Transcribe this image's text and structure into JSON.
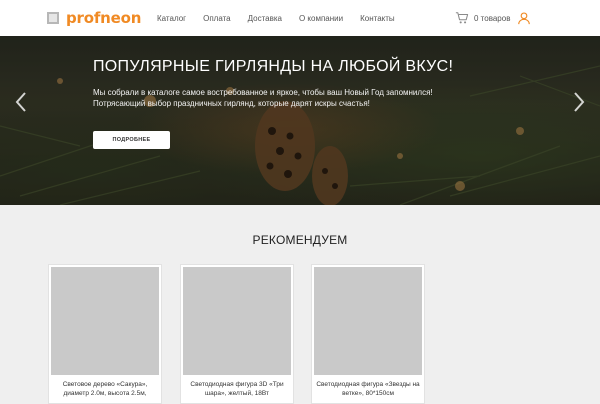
{
  "header": {
    "logo_text": "profneon",
    "nav": [
      "Каталог",
      "Оплата",
      "Доставка",
      "О компании",
      "Контакты"
    ],
    "cart_label": "0 товаров",
    "accent_color": "#f08a24"
  },
  "hero": {
    "title": "ПОПУЛЯРНЫЕ ГИРЛЯНДЫ НА ЛЮБОЙ ВКУС!",
    "description": "Мы собрали в каталоге самое востребованное и яркое, чтобы ваш Новый Год запомнился! Потрясающий выбор праздничных гирлянд, которые дарят искры счастья!",
    "button_label": "ПОДРОБНЕЕ",
    "prev_icon": "chevron-left-icon",
    "next_icon": "chevron-right-icon"
  },
  "recommend": {
    "title": "РЕКОМЕНДУЕМ",
    "products": [
      {
        "name": "Световое дерево «Сакура», диаметр 2.0м, высота 2.5м,"
      },
      {
        "name": "Светодиодная фигура 3D «Три шара», желтый, 18Вт"
      },
      {
        "name": "Светодиодная фигура «Звезды на ветке», 80*150см"
      }
    ]
  }
}
